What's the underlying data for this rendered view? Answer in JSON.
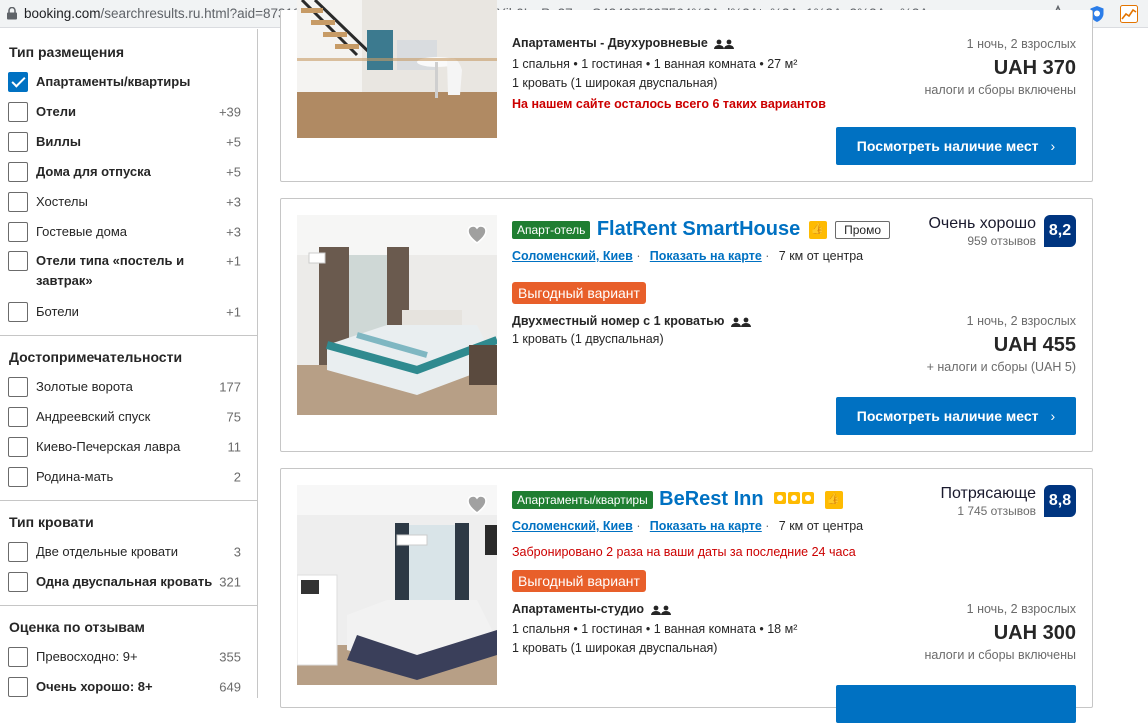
{
  "browser": {
    "url_host": "booking.com",
    "url_rest": "/searchresults.ru.html?aid=873184&label=zaporizhzhya-JlXhlqdpbYjh0LwPn27rngS424385397564%3Apl%3Ata%3Ap1%3Ap2%3Aac%3A..."
  },
  "sidebar": {
    "groups": [
      {
        "title": "Тип размещения",
        "items": [
          {
            "label": "Апартаменты/квартиры",
            "count": "",
            "checked": true
          },
          {
            "label": "Отели",
            "count": "+39"
          },
          {
            "label": "Виллы",
            "count": "+5"
          },
          {
            "label": "Дома для отпуска",
            "count": "+5"
          },
          {
            "label": "Хостелы",
            "count": "+3"
          },
          {
            "label": "Гостевые дома",
            "count": "+3"
          },
          {
            "label": "Отели типа «постель и завтрак»",
            "count": "+1"
          },
          {
            "label": "Ботели",
            "count": "+1"
          }
        ]
      },
      {
        "title": "Достопримечательности",
        "items": [
          {
            "label": "Золотые ворота",
            "count": "177"
          },
          {
            "label": "Андреевский спуск",
            "count": "75"
          },
          {
            "label": "Киево-Печерская лавра",
            "count": "11"
          },
          {
            "label": "Родина-мать",
            "count": "2"
          }
        ]
      },
      {
        "title": "Тип кровати",
        "items": [
          {
            "label": "Две отдельные кровати",
            "count": "3"
          },
          {
            "label": "Одна двуспальная кровать",
            "count": "321"
          }
        ]
      },
      {
        "title": "Оценка по отзывам",
        "items": [
          {
            "label": "Превосходно: 9+",
            "count": "355"
          },
          {
            "label": "Очень хорошо: 8+",
            "count": "649"
          }
        ]
      }
    ]
  },
  "cards": [
    {
      "room_title": "Апартаменты - Двухуровневые",
      "room_line1": "1 спальня • 1 гостиная • 1 ванная комната • 27 м²",
      "room_line2": "1 кровать (1 широкая двуспальная)",
      "scarcity": "На нашем сайте осталось всего 6 таких вариантов",
      "price_meta": "1 ночь, 2 взрослых",
      "price": "UAH 370",
      "tax": "налоги и сборы включены",
      "button": "Посмотреть наличие мест",
      "button_chevron": "›"
    },
    {
      "type_badge": "Апарт-отель",
      "name": "FlatRent SmartHouse",
      "promo": "Промо",
      "district": "Соломенский, Киев",
      "map_link": "Показать на карте",
      "distance": "7 км от центра",
      "deal": "Выгодный вариант",
      "room_title": "Двухместный номер с 1 кроватью",
      "room_line1": "1 кровать (1 двуспальная)",
      "rating_label": "Очень хорошо",
      "reviews": "959 отзывов",
      "score": "8,2",
      "price_meta": "1 ночь, 2 взрослых",
      "price": "UAH 455",
      "tax": "+ налоги и сборы (UAH 5)",
      "button": "Посмотреть наличие мест",
      "button_chevron": "›"
    },
    {
      "type_badge": "Апартаменты/квартиры",
      "name": "BeRest Inn",
      "stars": 3,
      "district": "Соломенский, Киев",
      "map_link": "Показать на карте",
      "distance": "7 км от центра",
      "booked_note": "Забронировано 2 раза на ваши даты за последние 24 часа",
      "deal": "Выгодный вариант",
      "room_title": "Апартаменты-студио",
      "room_line1": "1 спальня • 1 гостиная • 1 ванная комната • 18 м²",
      "room_line2": "1 кровать (1 широкая двуспальная)",
      "rating_label": "Потрясающе",
      "reviews": "1 745 отзывов",
      "score": "8,8",
      "price_meta": "1 ночь, 2 взрослых",
      "price": "UAH 300",
      "tax": "налоги и сборы включены"
    }
  ],
  "colors": {
    "brand_blue": "#0071c2",
    "navy": "#003580",
    "deal_orange": "#e85f2a",
    "badge_green": "#1f7e31",
    "star_yellow": "#febb02"
  }
}
